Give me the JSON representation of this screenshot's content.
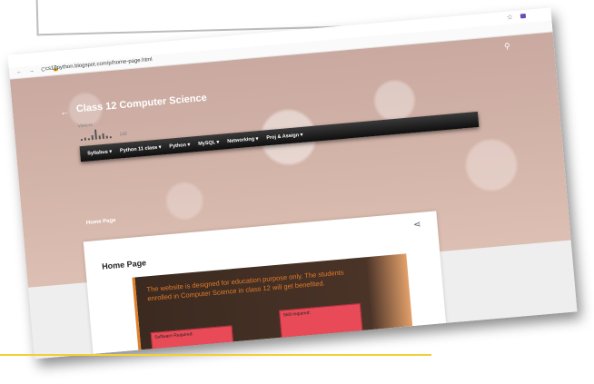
{
  "browser": {
    "url": "cs12python.blogspot.com/p/home-page.html",
    "nav_glyphs": "← → C 🔒"
  },
  "blog": {
    "title": "Class 12 Computer Science",
    "visitors_label": "Visitors",
    "visitor_count": "142",
    "breadcrumb": "Home Page",
    "nav_items": [
      "Syllabus ▾",
      "Python 11 class ▾",
      "Python ▾",
      "MySQL ▾",
      "Networking ▾",
      "Proj & Assign ▾"
    ]
  },
  "post": {
    "title": "Home Page",
    "body_text": "The website is designed for education purpose only. The students enrolled in Computer Science in class 12 will get benefited.",
    "box1_label": "Software Required:",
    "box2_label": "Skill required:"
  },
  "icons": {
    "search": "search-icon",
    "share": "share-icon",
    "back": "back-arrow-icon",
    "star": "star-icon"
  },
  "colors": {
    "navbar": "#1a1a1a",
    "accent_orange": "#e07a2a",
    "box_red": "#e84b57",
    "underline_yellow": "#f2cf3a"
  }
}
